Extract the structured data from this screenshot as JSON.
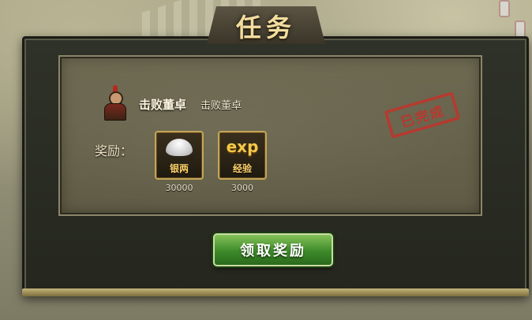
{
  "window": {
    "title": "任务"
  },
  "quest": {
    "name": "击败董卓",
    "description": "击败董卓",
    "status_stamp": "已完成"
  },
  "rewards": {
    "label": "奖励：",
    "items": [
      {
        "icon": "silver-ingot-icon",
        "name": "银两",
        "value": "30000"
      },
      {
        "icon": "exp-icon",
        "icon_text": "exp",
        "name": "经验",
        "value": "3000"
      }
    ]
  },
  "actions": {
    "claim_label": "领取奖励"
  },
  "colors": {
    "title": "#f3dd9f",
    "stamp": "#c3332a",
    "button": "#3d8a2a",
    "reward_border": "#c6a456"
  }
}
